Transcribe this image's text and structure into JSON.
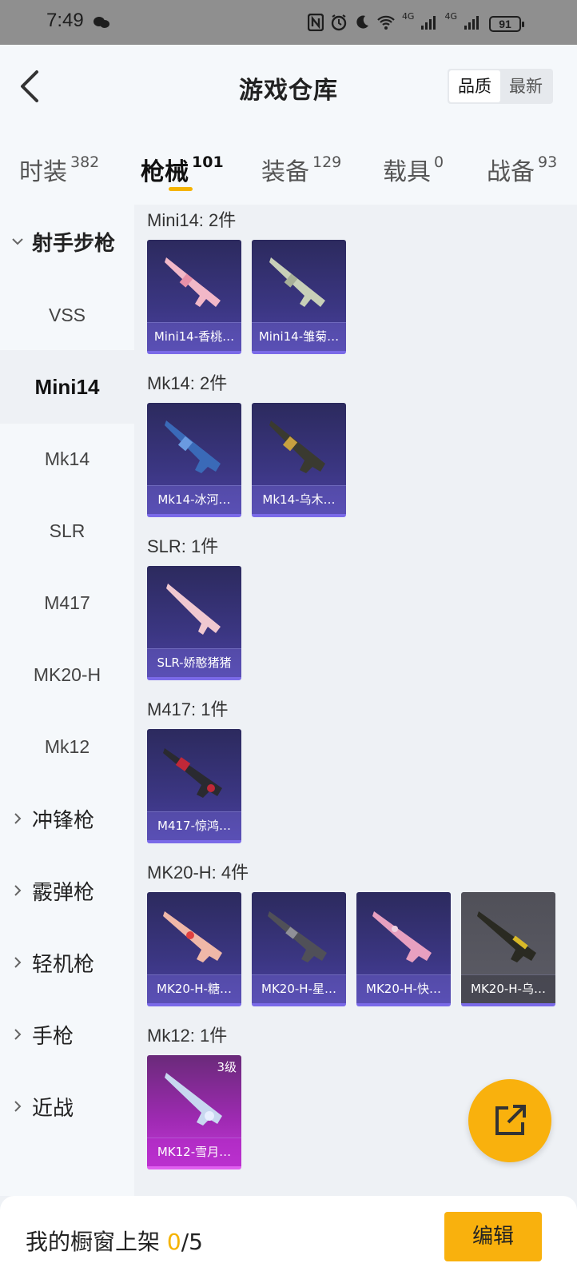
{
  "status_bar": {
    "time": "7:49",
    "battery": "91",
    "net1": "4G",
    "net2": "4G"
  },
  "header": {
    "title": "游戏仓库",
    "sort_quality": "品质",
    "sort_latest": "最新"
  },
  "tabs": [
    {
      "label": "时装",
      "count": "382"
    },
    {
      "label": "枪械",
      "count": "101"
    },
    {
      "label": "装备",
      "count": "129"
    },
    {
      "label": "载具",
      "count": "0"
    },
    {
      "label": "战备",
      "count": "93"
    }
  ],
  "sidebar": {
    "group_sniper": "射手步枪",
    "subs": [
      "VSS",
      "Mini14",
      "Mk14",
      "SLR",
      "M417",
      "MK20-H",
      "Mk12"
    ],
    "group_smg": "冲锋枪",
    "group_shotgun": "霰弹枪",
    "group_lmg": "轻机枪",
    "group_pistol": "手枪",
    "group_melee": "近战"
  },
  "sections": [
    {
      "title": "Mini14: 2件",
      "items": [
        "Mini14-香桃…",
        "Mini14-雏菊…"
      ]
    },
    {
      "title": "Mk14: 2件",
      "items": [
        "Mk14-冰河…",
        "Mk14-乌木…"
      ]
    },
    {
      "title": "SLR: 1件",
      "items": [
        "SLR-娇憨猪猪"
      ]
    },
    {
      "title": "M417: 1件",
      "items": [
        "M417-惊鸿…"
      ]
    },
    {
      "title": "MK20-H: 4件",
      "items": [
        "MK20-H-糖…",
        "MK20-H-星…",
        "MK20-H-快…",
        "MK20-H-乌…"
      ]
    },
    {
      "title": "Mk12: 1件",
      "items": [
        "MK12-雪月…"
      ],
      "level": "3级"
    }
  ],
  "bottom": {
    "prefix": "我的橱窗上架 ",
    "current": "0",
    "total": "/5",
    "edit": "编辑"
  },
  "colors": {
    "accent": "#f9b10d",
    "card_blue": "#3b3682",
    "card_pink": "#c23cd6"
  },
  "icons": [
    "back-icon",
    "external-link-icon",
    "chevron-down-icon",
    "chevron-right-icon",
    "nfc-icon",
    "alarm-icon",
    "moon-icon",
    "wifi-icon",
    "signal-icon",
    "wechat-icon"
  ]
}
